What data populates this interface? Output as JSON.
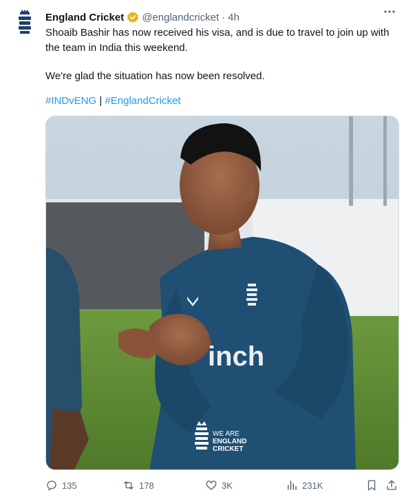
{
  "author": {
    "name": "England Cricket",
    "handle": "@englandcricket",
    "separator": "·",
    "time": "4h"
  },
  "tweet": {
    "line1": "Shoaib Bashir has now received his visa, and is due to travel to join up with the team in India this weekend.",
    "line2": "We're glad the situation has now been resolved.",
    "hashtag1": "#INDvENG",
    "divider": "|",
    "hashtag2": "#EnglandCricket"
  },
  "media": {
    "watermark_line1": "WE ARE",
    "watermark_line2": "ENGLAND",
    "watermark_line3": "CRICKET",
    "shirt_sponsor": "inch"
  },
  "actions": {
    "replies": "135",
    "reposts": "178",
    "likes": "3K",
    "views": "231K"
  },
  "colors": {
    "accent": "#1d9bf0",
    "verified": "#e2b719",
    "muted": "#536471",
    "jersey": "#1f4f73"
  }
}
